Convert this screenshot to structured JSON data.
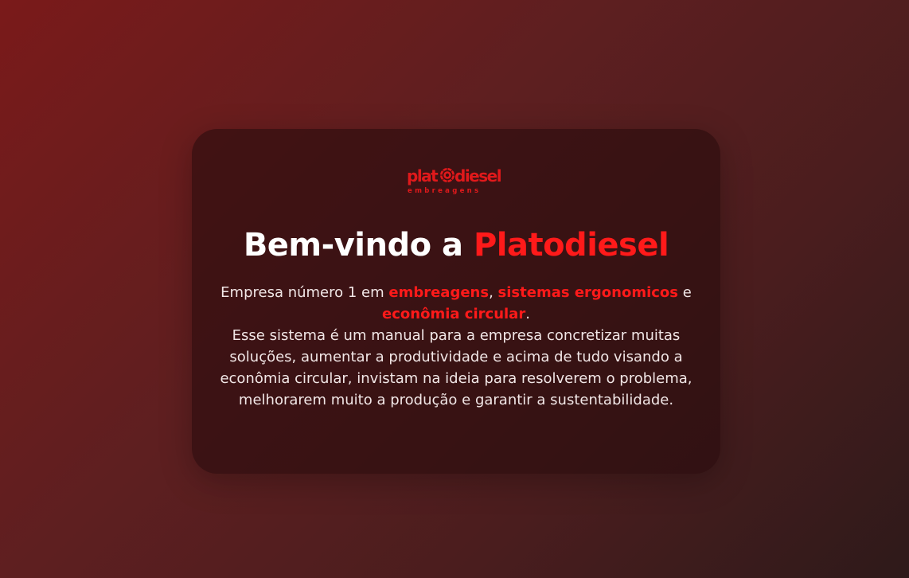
{
  "logo": {
    "wordmark_left": "plat",
    "wordmark_right": "diesel",
    "tagline": "embreagens",
    "color": "#e0191b"
  },
  "welcome": {
    "title_prefix": "Bem-vindo a ",
    "title_brand": "Platodiesel"
  },
  "description": {
    "intro": "Empresa número 1 em ",
    "highlight_1": "embreagens",
    "sep_1": ", ",
    "highlight_2": "sistemas ergonomicos",
    "sep_2": " e ",
    "highlight_3": "econômia circular",
    "period": ".",
    "body": "Esse sistema é um manual para a empresa concretizar muitas soluções, aumentar a produtividade e acima de tudo visando a econômia circular, invistam na ideia para resolverem o problema, melhorarem muito a produção e garantir a sustentabilidade."
  },
  "colors": {
    "accent": "#ff1a1a",
    "text": "#f1e6e6",
    "card": "#280c0d"
  }
}
